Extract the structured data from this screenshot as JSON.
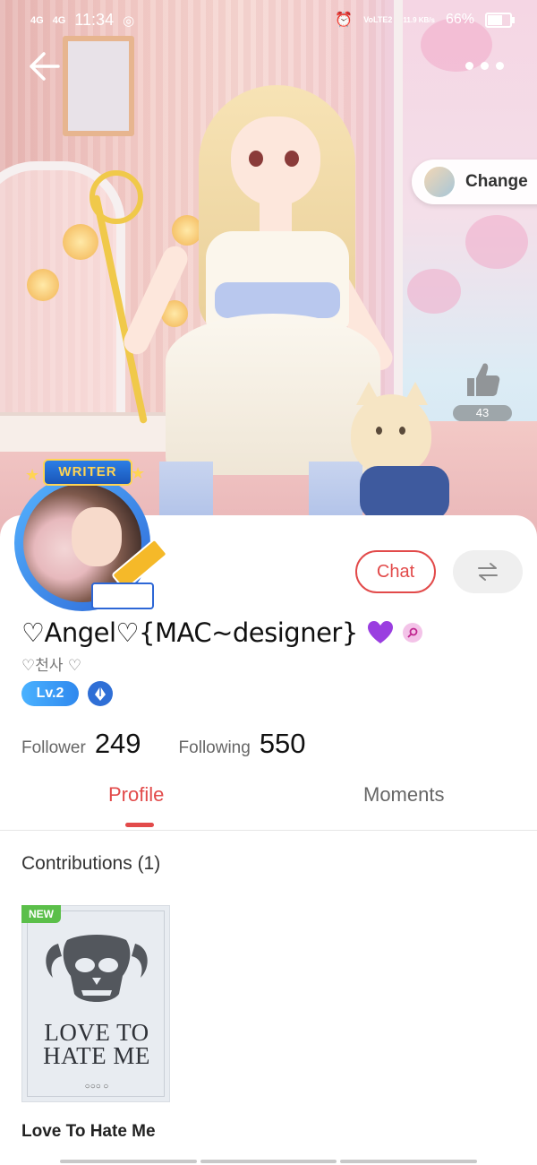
{
  "status_bar": {
    "signal_1": "4G",
    "signal_2": "4G",
    "time": "11:34",
    "network": "VoLTE2",
    "speed": "11.9 KB/s",
    "battery": "66%"
  },
  "header": {
    "back_icon": "arrow-left-icon",
    "more_icon": "more-dots-icon"
  },
  "cover": {
    "change_label": "Change",
    "like_count": "43"
  },
  "profile": {
    "badge_label": "WRITER",
    "username": "♡Angel♡{MAC~designer}",
    "subname": "♡천사 ♡",
    "level": "Lv.2",
    "chat_label": "Chat",
    "follower_label": "Follower",
    "follower_count": "249",
    "following_label": "Following",
    "following_count": "550"
  },
  "tabs": [
    {
      "label": "Profile",
      "active": true
    },
    {
      "label": "Moments",
      "active": false
    }
  ],
  "contributions": {
    "title": "Contributions (1)",
    "items": [
      {
        "tag": "NEW",
        "cover_title": "LOVE TO HATE ME",
        "cover_sub": "○○○ ○",
        "title": "Love To Hate Me"
      }
    ]
  },
  "colors": {
    "accent": "#e24a4a",
    "level_blue": "#2f88ee",
    "new_green": "#5bbf4a"
  }
}
